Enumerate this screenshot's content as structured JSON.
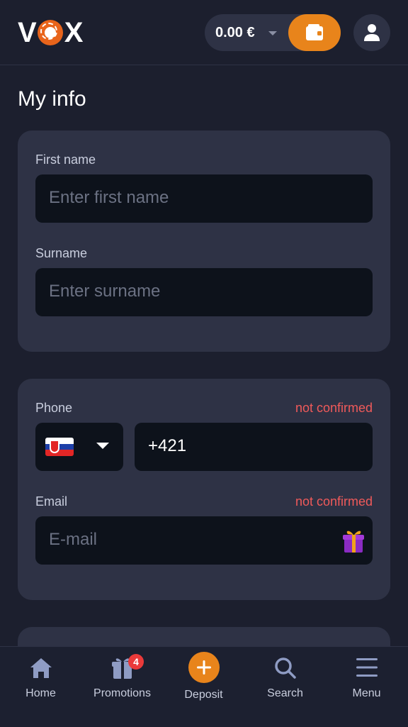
{
  "header": {
    "logo_text": "VOX",
    "balance": "0.00 €",
    "wallet_icon": "wallet-icon",
    "profile_icon": "user-icon"
  },
  "page": {
    "title": "My info"
  },
  "personal": {
    "first_name": {
      "label": "First name",
      "placeholder": "Enter first name",
      "value": ""
    },
    "surname": {
      "label": "Surname",
      "placeholder": "Enter surname",
      "value": ""
    }
  },
  "contact": {
    "phone": {
      "label": "Phone",
      "status": "not confirmed",
      "country_flag": "slovakia-flag-icon",
      "value": "+421"
    },
    "email": {
      "label": "Email",
      "status": "not confirmed",
      "placeholder": "E-mail",
      "value": "",
      "gift_icon": "gift-icon"
    }
  },
  "bottom_nav": {
    "items": [
      {
        "label": "Home",
        "icon": "home-icon"
      },
      {
        "label": "Promotions",
        "icon": "gift-icon",
        "badge": "4"
      },
      {
        "label": "Deposit",
        "icon": "plus-icon"
      },
      {
        "label": "Search",
        "icon": "search-icon"
      },
      {
        "label": "Menu",
        "icon": "hamburger-icon"
      }
    ]
  },
  "colors": {
    "background": "#1c1f2e",
    "card": "#2e3245",
    "input": "#0d121b",
    "accent": "#e8841b",
    "warning": "#f05a5a"
  }
}
